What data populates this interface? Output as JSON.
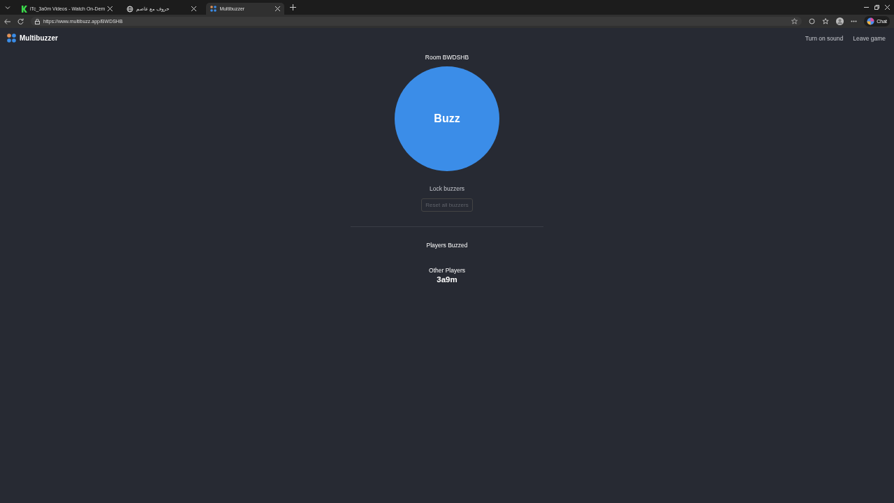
{
  "browser": {
    "tabs": [
      {
        "title": "iTc_3a0m Videos - Watch On-Dem",
        "kind": "k",
        "selected": false
      },
      {
        "title": "حروف مع عاصم",
        "kind": "globe",
        "selected": false
      },
      {
        "title": "Multibuzzer",
        "kind": "grid",
        "selected": true
      }
    ],
    "url": "https://www.multibuzz.app/BWDSHB",
    "chat_label": "Chat"
  },
  "app": {
    "logo": "Multibuzzer",
    "nav": [
      "Turn on sound",
      "Leave game"
    ],
    "room": "Room BWDSHB",
    "buzz": "Buzz",
    "lock": "Lock buzzers",
    "reset": {
      "label": "Reset all buzzers",
      "disabled": true
    },
    "buzzed_heading": "Players Buzzed",
    "other_heading": "Other Players",
    "players": [
      "3a9m"
    ]
  }
}
